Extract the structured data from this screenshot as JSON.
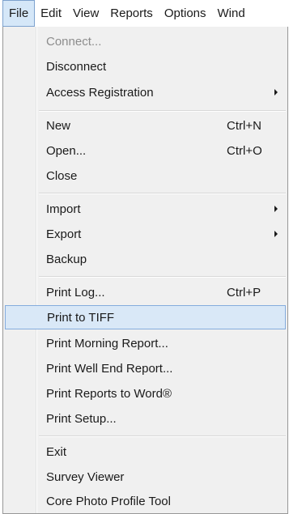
{
  "menubar": {
    "items": [
      {
        "label": "File"
      },
      {
        "label": "Edit"
      },
      {
        "label": "View"
      },
      {
        "label": "Reports"
      },
      {
        "label": "Options"
      },
      {
        "label": "Wind"
      }
    ]
  },
  "file_menu": {
    "items": [
      {
        "label": "Connect...",
        "shortcut": "",
        "submenu": false,
        "disabled": true
      },
      {
        "label": "Disconnect",
        "shortcut": "",
        "submenu": false
      },
      {
        "label": "Access Registration",
        "shortcut": "",
        "submenu": true
      },
      {
        "label": "New",
        "shortcut": "Ctrl+N",
        "submenu": false
      },
      {
        "label": "Open...",
        "shortcut": "Ctrl+O",
        "submenu": false
      },
      {
        "label": "Close",
        "shortcut": "",
        "submenu": false
      },
      {
        "label": "Import",
        "shortcut": "",
        "submenu": true
      },
      {
        "label": "Export",
        "shortcut": "",
        "submenu": true
      },
      {
        "label": "Backup",
        "shortcut": "",
        "submenu": false
      },
      {
        "label": "Print Log...",
        "shortcut": "Ctrl+P",
        "submenu": false
      },
      {
        "label": "Print to TIFF",
        "shortcut": "",
        "submenu": false,
        "highlighted": true
      },
      {
        "label": "Print Morning Report...",
        "shortcut": "",
        "submenu": false
      },
      {
        "label": "Print Well End Report...",
        "shortcut": "",
        "submenu": false
      },
      {
        "label": "Print Reports to Word®",
        "shortcut": "",
        "submenu": false
      },
      {
        "label": "Print Setup...",
        "shortcut": "",
        "submenu": false
      },
      {
        "label": "Exit",
        "shortcut": "",
        "submenu": false
      },
      {
        "label": "Survey Viewer",
        "shortcut": "",
        "submenu": false
      },
      {
        "label": "Core Photo Profile Tool",
        "shortcut": "",
        "submenu": false
      }
    ]
  }
}
